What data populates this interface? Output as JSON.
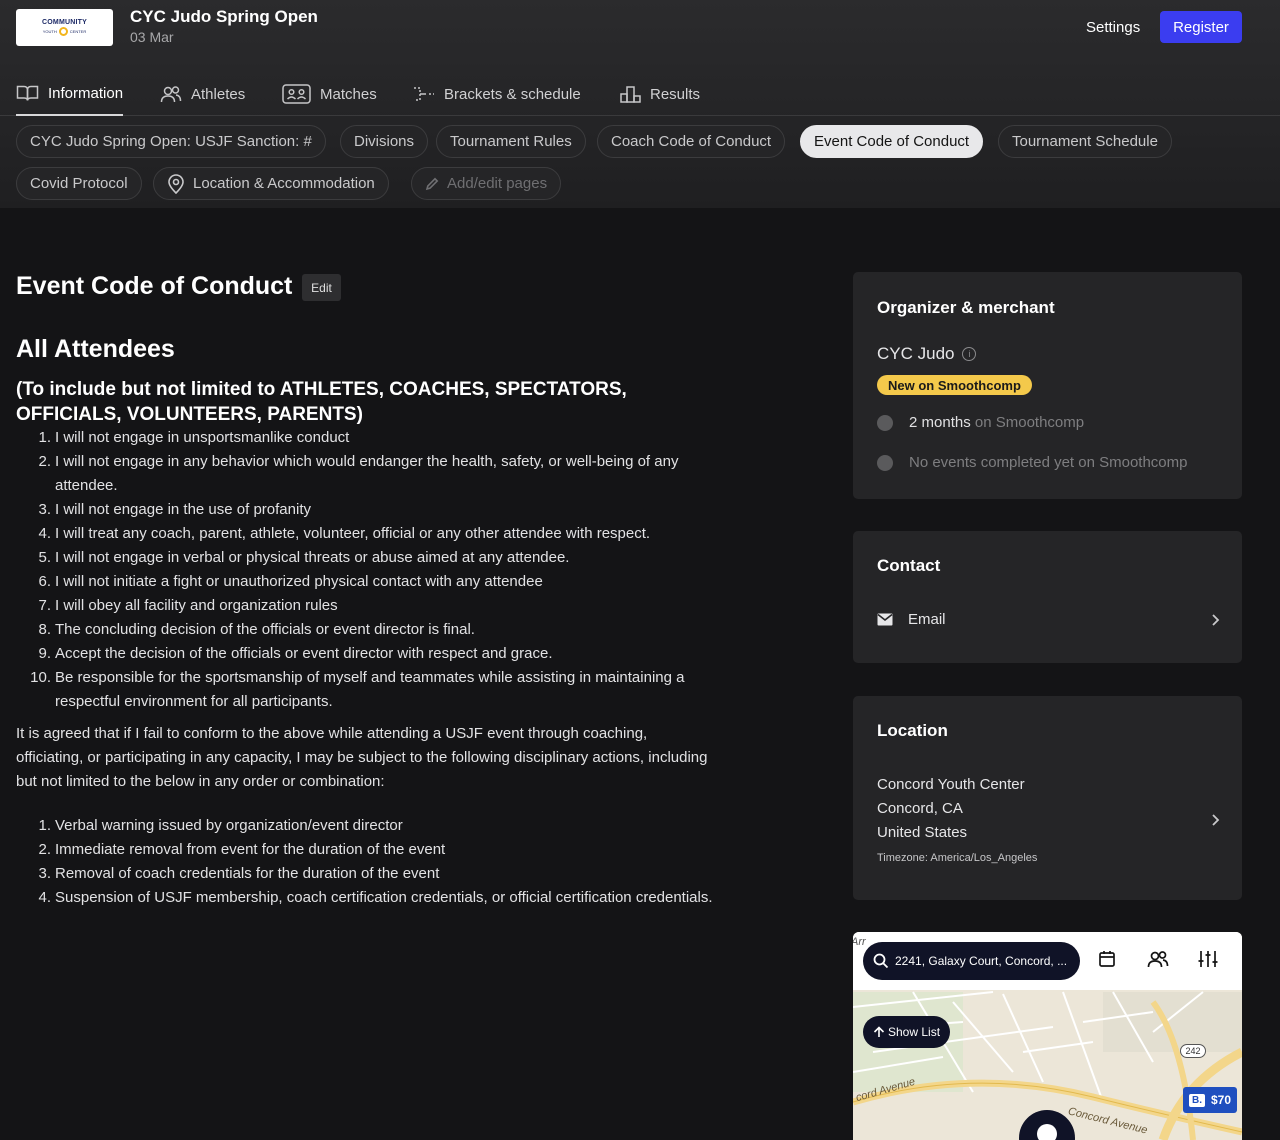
{
  "header": {
    "logo_line1": "COMMUNITY",
    "logo_line2a": "YOUTH",
    "logo_line2b": "CENTER",
    "title": "CYC Judo Spring Open",
    "date": "03 Mar",
    "settings_label": "Settings",
    "register_label": "Register"
  },
  "tabs": [
    {
      "label": "Information",
      "icon": "book-icon"
    },
    {
      "label": "Athletes",
      "icon": "users-icon"
    },
    {
      "label": "Matches",
      "icon": "matches-icon"
    },
    {
      "label": "Brackets & schedule",
      "icon": "bracket-icon"
    },
    {
      "label": "Results",
      "icon": "podium-icon"
    }
  ],
  "pages": [
    "CYC Judo Spring Open: USJF Sanction: #",
    "Divisions",
    "Tournament Rules",
    "Coach Code of Conduct",
    "Event Code of Conduct",
    "Tournament Schedule",
    "Covid Protocol",
    "Location & Accommodation",
    "Add/edit pages"
  ],
  "content": {
    "title": "Event Code of Conduct",
    "edit_label": "Edit",
    "heading": "All Attendees",
    "subheading": "(To include but not limited to ATHLETES, COACHES, SPECTATORS, OFFICIALS, VOLUNTEERS, PARENTS)",
    "rules": [
      {
        "num": "1.",
        "text": "I will not engage in unsportsmanlike conduct"
      },
      {
        "num": "2.",
        "text": "I will not engage in any behavior which would endanger the health, safety, or well-being of any attendee."
      },
      {
        "num": "3.",
        "text": "I will not engage in the use of profanity"
      },
      {
        "num": "4.",
        "text": "I will treat any coach, parent, athlete, volunteer, official or any other attendee with respect."
      },
      {
        "num": "5.",
        "text": "I will not engage in verbal or physical threats or abuse aimed at any attendee."
      },
      {
        "num": "6.",
        "text": "I will not initiate a fight or unauthorized physical contact with any attendee"
      },
      {
        "num": "7.",
        "text": " I will obey all facility and organization rules"
      },
      {
        "num": "8.",
        "text": "The concluding decision of the officials or event director is final."
      },
      {
        "num": "9.",
        "text": "Accept the decision of the officials or event director with respect and grace."
      },
      {
        "num": "10.",
        "text": "Be responsible for the sportsmanship of myself and teammates while assisting in maintaining a respectful environment for all participants."
      }
    ],
    "paragraph": "It is agreed that if I fail to conform to the above while attending a USJF event through coaching, officiating, or participating in any capacity, I may be subject to the following disciplinary actions, including but not limited to the below in any order or combination:",
    "actions": [
      {
        "num": "1.",
        "text": "Verbal warning issued by organization/event director"
      },
      {
        "num": "2.",
        "text": "Immediate removal from event for the duration of the event"
      },
      {
        "num": "3.",
        "text": "Removal of coach credentials for the duration of the event"
      },
      {
        "num": "4.",
        "text": "Suspension of USJF membership, coach certification credentials, or official certification credentials."
      }
    ]
  },
  "organizer": {
    "heading": "Organizer & merchant",
    "name": "CYC Judo",
    "badge": "New on Smoothcomp",
    "stat1_strong": "2 months",
    "stat1_rest": " on Smoothcomp",
    "stat2": "No events completed yet on Smoothcomp"
  },
  "contact": {
    "heading": "Contact",
    "email_label": "Email"
  },
  "location": {
    "heading": "Location",
    "line1": "Concord Youth Center",
    "line2": "Concord, CA",
    "line3": "United States",
    "timezone": "Timezone: America/Los_Angeles"
  },
  "map": {
    "search_text": "2241, Galaxy Court, Concord, ...",
    "show_list": "Show List",
    "route": "242",
    "price_b": "B.",
    "price": "$70",
    "road1": "cord Avenue",
    "road2": "Concord Avenue",
    "corner": "Arr"
  },
  "colors": {
    "accent": "#3b3df0",
    "badge": "#f4c94b",
    "background": "#141416",
    "card": "#252527"
  }
}
